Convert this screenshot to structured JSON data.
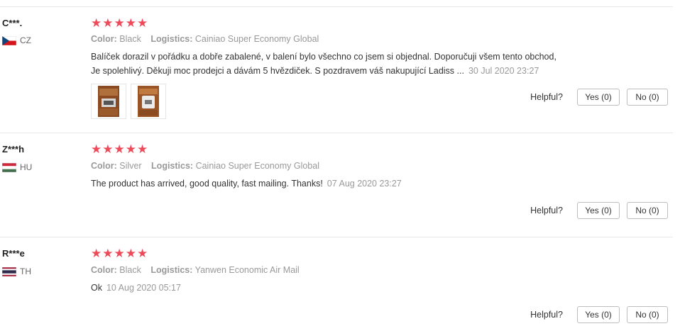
{
  "helpful_label": "Helpful?",
  "color_key": "Color:",
  "logistics_key": "Logistics:",
  "reviews": [
    {
      "user": "C***.",
      "country": "CZ",
      "flag": "cz-flag",
      "rating_stars": "★★★★★",
      "rating": 5,
      "color": "Black",
      "logistics": "Cainiao Super Economy Global",
      "text_line1": "Balíček dorazil v pořádku a dobře zabalené, v balení bylo všechno co jsem si objednal. Doporučuji všem tento obchod,",
      "text_line2": "Je spolehlivý. Děkuji moc prodejci a dávám 5 hvězdiček. S pozdravem váš nakupující Ladiss ...",
      "date": "30 Jul 2020 23:27",
      "yes": "Yes (0)",
      "no": "No (0)"
    },
    {
      "user": "Z***h",
      "country": "HU",
      "flag": "hu-flag",
      "rating_stars": "★★★★★",
      "rating": 5,
      "color": "Silver",
      "logistics": "Cainiao Super Economy Global",
      "text_line1": "The product has arrived, good quality, fast mailing. Thanks!",
      "date": "07 Aug 2020 23:27",
      "yes": "Yes (0)",
      "no": "No (0)"
    },
    {
      "user": "R***e",
      "country": "TH",
      "flag": "th-flag",
      "rating_stars": "★★★★★",
      "rating": 5,
      "color": "Black",
      "logistics": "Yanwen Economic Air Mail",
      "text_line1": "Ok",
      "date": "10 Aug 2020 05:17",
      "yes": "Yes (0)",
      "no": "No (0)"
    }
  ]
}
